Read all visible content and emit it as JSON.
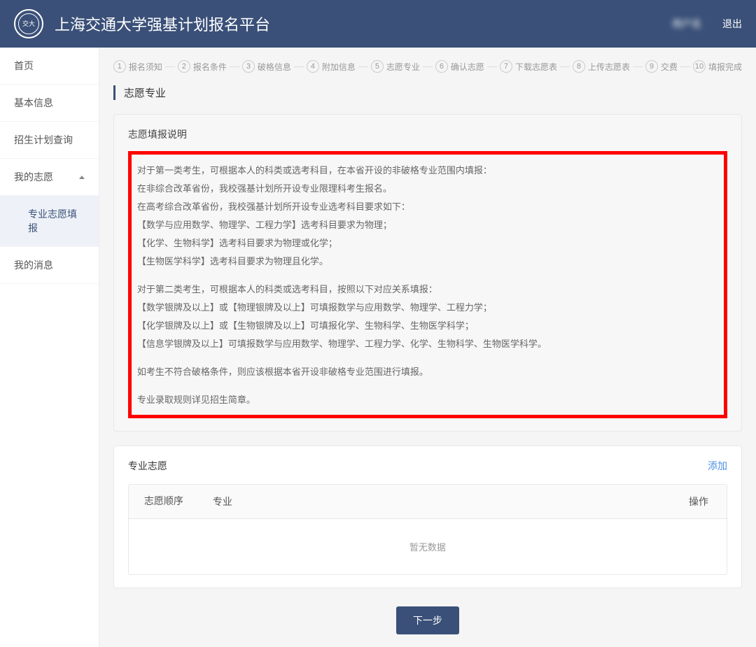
{
  "header": {
    "title": "上海交通大学强基计划报名平台",
    "user": "用户名",
    "exit": "退出"
  },
  "sidebar": {
    "items": [
      {
        "label": "首页"
      },
      {
        "label": "基本信息"
      },
      {
        "label": "招生计划查询"
      },
      {
        "label": "我的志愿"
      },
      {
        "label": "专业志愿填报"
      },
      {
        "label": "我的消息"
      }
    ]
  },
  "steps": [
    {
      "num": "1",
      "label": "报名须知"
    },
    {
      "num": "2",
      "label": "报名条件"
    },
    {
      "num": "3",
      "label": "破格信息"
    },
    {
      "num": "4",
      "label": "附加信息"
    },
    {
      "num": "5",
      "label": "志愿专业"
    },
    {
      "num": "6",
      "label": "确认志愿"
    },
    {
      "num": "7",
      "label": "下载志愿表"
    },
    {
      "num": "8",
      "label": "上传志愿表"
    },
    {
      "num": "9",
      "label": "交费"
    },
    {
      "num": "10",
      "label": "填报完成"
    }
  ],
  "page": {
    "heading": "志愿专业"
  },
  "instructions": {
    "title": "志愿填报说明",
    "p1": "对于第一类考生，可根据本人的科类或选考科目，在本省开设的非破格专业范围内填报：",
    "p2": "在非综合改革省份，我校强基计划所开设专业限理科考生报名。",
    "p3": "在高考综合改革省份，我校强基计划所开设专业选考科目要求如下：",
    "p4": "【数学与应用数学、物理学、工程力学】选考科目要求为物理；",
    "p5": "【化学、生物科学】选考科目要求为物理或化学；",
    "p6": "【生物医学科学】选考科目要求为物理且化学。",
    "p7": "对于第二类考生，可根据本人的科类或选考科目，按照以下对应关系填报：",
    "p8": "【数学银牌及以上】或【物理银牌及以上】可填报数学与应用数学、物理学、工程力学；",
    "p9": "【化学银牌及以上】或【生物银牌及以上】可填报化学、生物科学、生物医学科学；",
    "p10": "【信息学银牌及以上】可填报数学与应用数学、物理学、工程力学、化学、生物科学、生物医学科学。",
    "p11": "如考生不符合破格条件，则应该根据本省开设非破格专业范围进行填报。",
    "p12": "专业录取规则详见招生简章。"
  },
  "preferences": {
    "title": "专业志愿",
    "add": "添加",
    "columns": {
      "order": "志愿顺序",
      "major": "专业",
      "action": "操作"
    },
    "empty": "暂无数据"
  },
  "buttons": {
    "next": "下一步"
  }
}
